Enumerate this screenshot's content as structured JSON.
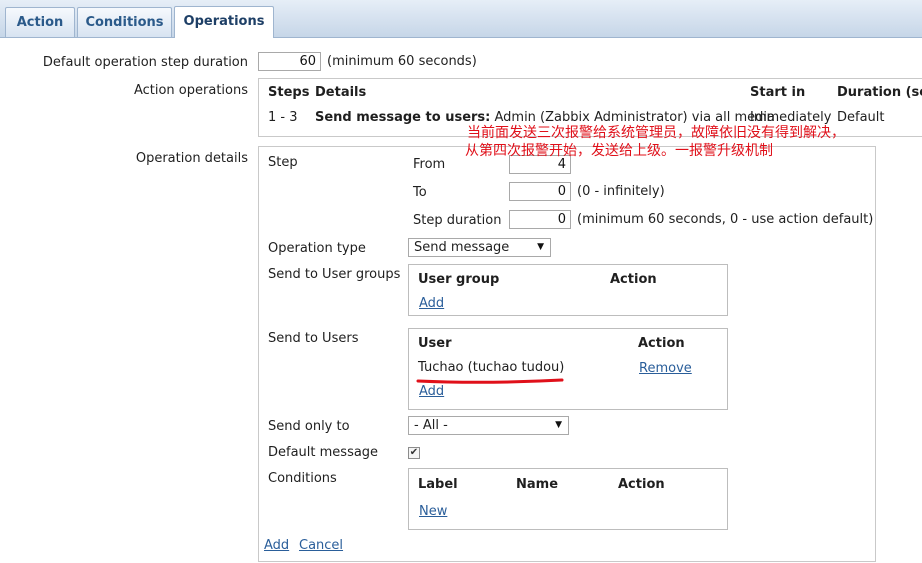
{
  "tabs": [
    {
      "label": "Action",
      "active": false
    },
    {
      "label": "Conditions",
      "active": false
    },
    {
      "label": "Operations",
      "active": true
    }
  ],
  "form": {
    "default_step_duration_label": "Default operation step duration",
    "default_step_duration_value": "60",
    "default_step_duration_hint": "(minimum 60 seconds)",
    "action_operations_label": "Action operations",
    "operation_details_label": "Operation details"
  },
  "operations_table": {
    "headers": [
      "Steps",
      "Details",
      "Start in",
      "Duration (sec"
    ],
    "row": {
      "steps": "1 - 3",
      "details_bold": "Send message to users:",
      "details_rest": " Admin (Zabbix Administrator) via all media",
      "start_in": "Immediately",
      "duration": "Default"
    }
  },
  "annotation": {
    "line1": "当前面发送三次报警给系统管理员，故障依旧没有得到解决，",
    "line2": "从第四次报警开始，发送给上级。一报警升级机制",
    "color": "#e0101a"
  },
  "details": {
    "step_label": "Step",
    "from_label": "From",
    "from_value": "4",
    "to_label": "To",
    "to_value": "0",
    "to_hint": "(0 - infinitely)",
    "step_duration_label": "Step duration",
    "step_duration_value": "0",
    "step_duration_hint": "(minimum 60 seconds, 0 - use action default)",
    "operation_type_label": "Operation type",
    "operation_type_value": "Send message",
    "send_user_groups_label": "Send to User groups",
    "user_groups_headers": [
      "User group",
      "Action"
    ],
    "user_groups_add": "Add",
    "send_users_label": "Send to Users",
    "users_headers": [
      "User",
      "Action"
    ],
    "users": [
      {
        "name": "Tuchao (tuchao tudou)",
        "action": "Remove"
      }
    ],
    "users_add": "Add",
    "send_only_to_label": "Send only to",
    "send_only_to_value": "- All -",
    "default_message_label": "Default message",
    "default_message_checked": true,
    "conditions_label": "Conditions",
    "conditions_headers": [
      "Label",
      "Name",
      "Action"
    ],
    "conditions_new": "New",
    "add_link": "Add",
    "cancel_link": "Cancel"
  },
  "colors": {
    "link": "#2a5e9a",
    "tab_text": "#2b5a8a",
    "underline_mark": "#e0101a"
  }
}
